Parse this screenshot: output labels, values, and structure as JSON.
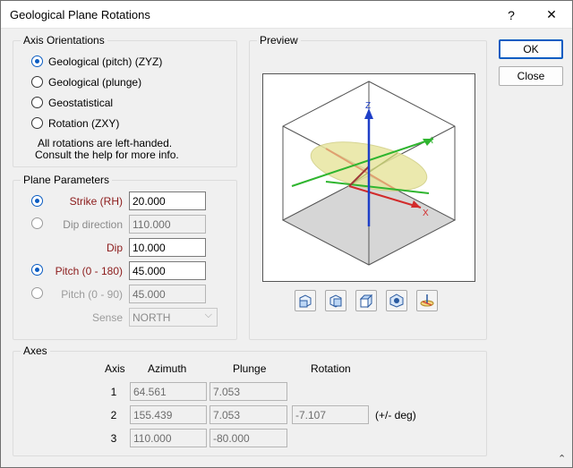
{
  "window": {
    "title": "Geological Plane Rotations",
    "help_label": "?",
    "close_label": "✕"
  },
  "buttons": {
    "ok": "OK",
    "close": "Close"
  },
  "axis_orientations": {
    "label": "Axis Orientations",
    "options": [
      {
        "label": "Geological (pitch) (ZYZ)",
        "checked": true
      },
      {
        "label": "Geological (plunge)",
        "checked": false
      },
      {
        "label": "Geostatistical",
        "checked": false
      },
      {
        "label": "Rotation (ZXY)",
        "checked": false
      }
    ],
    "note_line1": "All rotations are left-handed.",
    "note_line2": "Consult the help for more info."
  },
  "plane_parameters": {
    "label": "Plane Parameters",
    "strike_label": "Strike (RH)",
    "strike_value": "20.000",
    "dip_direction_label": "Dip direction",
    "dip_direction_value": "110.000",
    "dip_label": "Dip",
    "dip_value": "10.000",
    "pitch180_label": "Pitch (0 - 180)",
    "pitch180_value": "45.000",
    "pitch90_label": "Pitch (0 - 90)",
    "pitch90_value": "45.000",
    "sense_label": "Sense",
    "sense_value": "NORTH"
  },
  "preview": {
    "label": "Preview",
    "axis_labels": {
      "z": "Z",
      "y": "Y",
      "x": "X"
    },
    "colors": {
      "z": "#1f3fc8",
      "y": "#2fb52f",
      "x": "#d22b2b",
      "plane": "#e8e6a0",
      "floor": "#d6d6d6"
    },
    "view_buttons": [
      "view-front-icon",
      "view-side-icon",
      "view-iso-icon",
      "view-rotate-icon",
      "view-plane-icon"
    ]
  },
  "axes": {
    "label": "Axes",
    "headers": {
      "axis": "Axis",
      "azimuth": "Azimuth",
      "plunge": "Plunge",
      "rotation": "Rotation"
    },
    "rows": [
      {
        "axis": "1",
        "azimuth": "64.561",
        "plunge": "7.053"
      },
      {
        "axis": "2",
        "azimuth": "155.439",
        "plunge": "7.053",
        "rotation": "-7.107"
      },
      {
        "axis": "3",
        "azimuth": "110.000",
        "plunge": "-80.000"
      }
    ],
    "rotation_unit": "(+/- deg)"
  }
}
